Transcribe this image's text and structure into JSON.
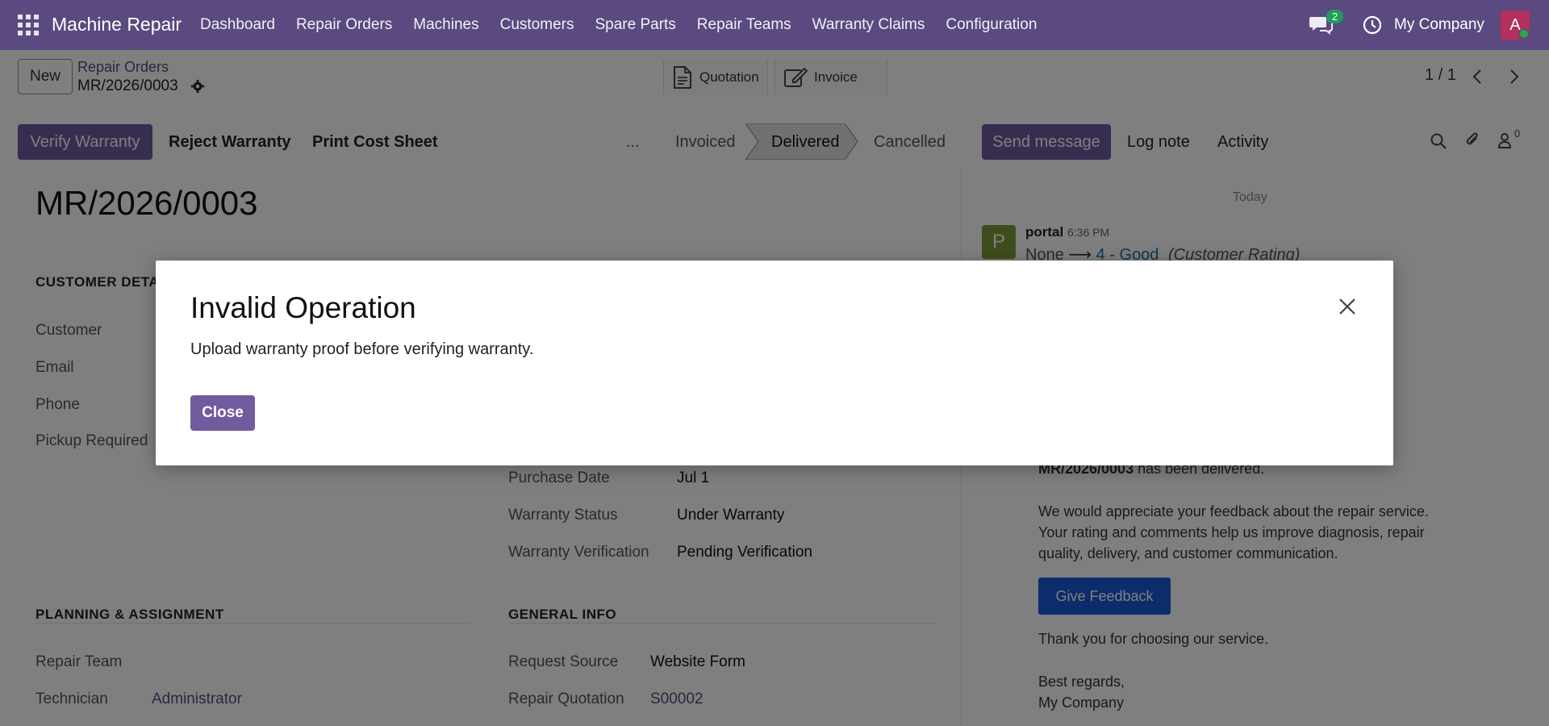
{
  "navbar": {
    "brand": "Machine Repair",
    "menu": [
      "Dashboard",
      "Repair Orders",
      "Machines",
      "Customers",
      "Spare Parts",
      "Repair Teams",
      "Warranty Claims",
      "Configuration"
    ],
    "chat_count": "2",
    "company": "My Company",
    "avatar_letter": "A"
  },
  "control": {
    "new_label": "New",
    "breadcrumb": "Repair Orders",
    "record": "MR/2026/0003",
    "smart_buttons": [
      "Quotation",
      "Invoice"
    ],
    "pager": "1 / 1"
  },
  "statusbar": {
    "actions": [
      "Verify Warranty",
      "Reject Warranty",
      "Print Cost Sheet"
    ],
    "more": "...",
    "stages": [
      "Invoiced",
      "Delivered",
      "Cancelled"
    ],
    "active_stage": "Delivered"
  },
  "chatter_bar": {
    "send": "Send message",
    "log": "Log note",
    "activity": "Activity",
    "followers": "0"
  },
  "form": {
    "title": "MR/2026/0003",
    "customer_section": "CUSTOMER DETA",
    "customer_labels": [
      "Customer",
      "Email",
      "Phone",
      "Pickup Required"
    ],
    "warranty_fields": [
      {
        "label": "Purchase Date",
        "value": "Jul 1"
      },
      {
        "label": "Warranty Status",
        "value": "Under Warranty"
      },
      {
        "label": "Warranty Verification",
        "value": "Pending Verification"
      }
    ],
    "planning_section": "PLANNING & ASSIGNMENT",
    "planning_fields": [
      {
        "label": "Repair Team",
        "value": ""
      },
      {
        "label": "Technician",
        "value": "Administrator"
      }
    ],
    "general_section": "GENERAL INFO",
    "general_fields": [
      {
        "label": "Request Source",
        "value": "Website Form"
      },
      {
        "label": "Repair Quotation",
        "value": "S00002"
      }
    ]
  },
  "chatter": {
    "today": "Today",
    "avatar_letter": "P",
    "author": "portal",
    "time": "6:36 PM",
    "track_old": "None",
    "track_arrow": "⟶",
    "track_new": "4 - Good",
    "track_field": "(Customer Rating)",
    "msg_ref": "MR/2026/0003",
    "msg_line1": " has been delivered.",
    "msg_para": [
      "We would appreciate your feedback about the repair service.",
      "Your rating and comments help us improve diagnosis, repair",
      "quality, delivery, and customer communication."
    ],
    "feedback_button": "Give Feedback",
    "thanks": "Thank you for choosing our service.",
    "regards": "Best regards,",
    "signature": "My Company"
  },
  "modal": {
    "title": "Invalid Operation",
    "body": "Upload warranty proof before verifying warranty.",
    "close_label": "Close"
  },
  "colors": {
    "navbar": "#5a4a80",
    "primary": "#6f5b9e",
    "feedback": "#1a58d6"
  }
}
